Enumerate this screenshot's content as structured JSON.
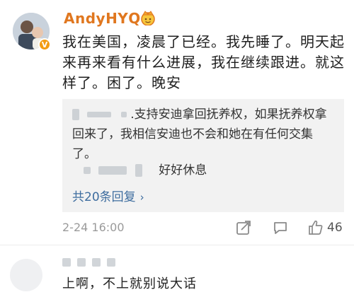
{
  "post": {
    "username": "AndyHYQ",
    "crown_icon": "crown-emoji-icon",
    "verified_badge": "V",
    "text": "我在美国，凌晨了已经。我先睡了。明天起来再来看有什么进展，我在继续跟进。就这样了。困了。晚安",
    "timestamp": "2-24 16:00",
    "like_count": "46",
    "icons": [
      "share-icon",
      "comment-icon",
      "like-icon"
    ]
  },
  "replies": {
    "reply1_text": ".支持安迪拿回抚养权，如果抚养权拿回来了，我相信安迪也不会和她在有任何交集了。",
    "reply2_text": "好好休息",
    "more_label": "共20条回复",
    "more_chevron": "›"
  },
  "comment": {
    "text": "上啊，不上就别说大话"
  },
  "colors": {
    "username": "#e0771f",
    "link": "#3e6d9f",
    "reply_bg": "#f2f2f2"
  }
}
